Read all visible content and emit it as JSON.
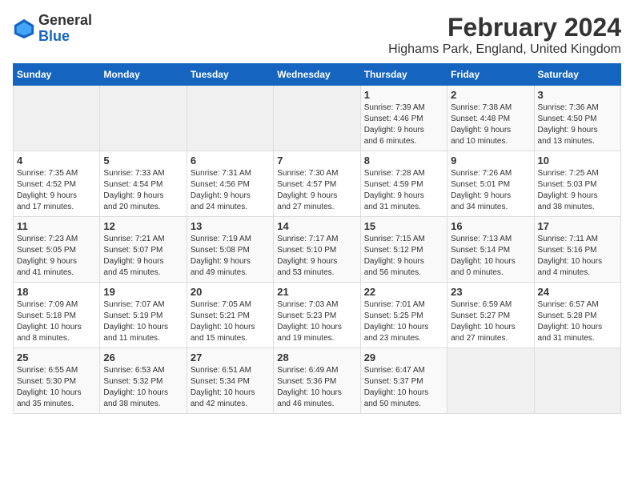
{
  "app": {
    "name_general": "General",
    "name_blue": "Blue"
  },
  "title": "February 2024",
  "subtitle": "Highams Park, England, United Kingdom",
  "days_of_week": [
    "Sunday",
    "Monday",
    "Tuesday",
    "Wednesday",
    "Thursday",
    "Friday",
    "Saturday"
  ],
  "weeks": [
    [
      {
        "day": "",
        "info": ""
      },
      {
        "day": "",
        "info": ""
      },
      {
        "day": "",
        "info": ""
      },
      {
        "day": "",
        "info": ""
      },
      {
        "day": "1",
        "info": "Sunrise: 7:39 AM\nSunset: 4:46 PM\nDaylight: 9 hours\nand 6 minutes."
      },
      {
        "day": "2",
        "info": "Sunrise: 7:38 AM\nSunset: 4:48 PM\nDaylight: 9 hours\nand 10 minutes."
      },
      {
        "day": "3",
        "info": "Sunrise: 7:36 AM\nSunset: 4:50 PM\nDaylight: 9 hours\nand 13 minutes."
      }
    ],
    [
      {
        "day": "4",
        "info": "Sunrise: 7:35 AM\nSunset: 4:52 PM\nDaylight: 9 hours\nand 17 minutes."
      },
      {
        "day": "5",
        "info": "Sunrise: 7:33 AM\nSunset: 4:54 PM\nDaylight: 9 hours\nand 20 minutes."
      },
      {
        "day": "6",
        "info": "Sunrise: 7:31 AM\nSunset: 4:56 PM\nDaylight: 9 hours\nand 24 minutes."
      },
      {
        "day": "7",
        "info": "Sunrise: 7:30 AM\nSunset: 4:57 PM\nDaylight: 9 hours\nand 27 minutes."
      },
      {
        "day": "8",
        "info": "Sunrise: 7:28 AM\nSunset: 4:59 PM\nDaylight: 9 hours\nand 31 minutes."
      },
      {
        "day": "9",
        "info": "Sunrise: 7:26 AM\nSunset: 5:01 PM\nDaylight: 9 hours\nand 34 minutes."
      },
      {
        "day": "10",
        "info": "Sunrise: 7:25 AM\nSunset: 5:03 PM\nDaylight: 9 hours\nand 38 minutes."
      }
    ],
    [
      {
        "day": "11",
        "info": "Sunrise: 7:23 AM\nSunset: 5:05 PM\nDaylight: 9 hours\nand 41 minutes."
      },
      {
        "day": "12",
        "info": "Sunrise: 7:21 AM\nSunset: 5:07 PM\nDaylight: 9 hours\nand 45 minutes."
      },
      {
        "day": "13",
        "info": "Sunrise: 7:19 AM\nSunset: 5:08 PM\nDaylight: 9 hours\nand 49 minutes."
      },
      {
        "day": "14",
        "info": "Sunrise: 7:17 AM\nSunset: 5:10 PM\nDaylight: 9 hours\nand 53 minutes."
      },
      {
        "day": "15",
        "info": "Sunrise: 7:15 AM\nSunset: 5:12 PM\nDaylight: 9 hours\nand 56 minutes."
      },
      {
        "day": "16",
        "info": "Sunrise: 7:13 AM\nSunset: 5:14 PM\nDaylight: 10 hours\nand 0 minutes."
      },
      {
        "day": "17",
        "info": "Sunrise: 7:11 AM\nSunset: 5:16 PM\nDaylight: 10 hours\nand 4 minutes."
      }
    ],
    [
      {
        "day": "18",
        "info": "Sunrise: 7:09 AM\nSunset: 5:18 PM\nDaylight: 10 hours\nand 8 minutes."
      },
      {
        "day": "19",
        "info": "Sunrise: 7:07 AM\nSunset: 5:19 PM\nDaylight: 10 hours\nand 11 minutes."
      },
      {
        "day": "20",
        "info": "Sunrise: 7:05 AM\nSunset: 5:21 PM\nDaylight: 10 hours\nand 15 minutes."
      },
      {
        "day": "21",
        "info": "Sunrise: 7:03 AM\nSunset: 5:23 PM\nDaylight: 10 hours\nand 19 minutes."
      },
      {
        "day": "22",
        "info": "Sunrise: 7:01 AM\nSunset: 5:25 PM\nDaylight: 10 hours\nand 23 minutes."
      },
      {
        "day": "23",
        "info": "Sunrise: 6:59 AM\nSunset: 5:27 PM\nDaylight: 10 hours\nand 27 minutes."
      },
      {
        "day": "24",
        "info": "Sunrise: 6:57 AM\nSunset: 5:28 PM\nDaylight: 10 hours\nand 31 minutes."
      }
    ],
    [
      {
        "day": "25",
        "info": "Sunrise: 6:55 AM\nSunset: 5:30 PM\nDaylight: 10 hours\nand 35 minutes."
      },
      {
        "day": "26",
        "info": "Sunrise: 6:53 AM\nSunset: 5:32 PM\nDaylight: 10 hours\nand 38 minutes."
      },
      {
        "day": "27",
        "info": "Sunrise: 6:51 AM\nSunset: 5:34 PM\nDaylight: 10 hours\nand 42 minutes."
      },
      {
        "day": "28",
        "info": "Sunrise: 6:49 AM\nSunset: 5:36 PM\nDaylight: 10 hours\nand 46 minutes."
      },
      {
        "day": "29",
        "info": "Sunrise: 6:47 AM\nSunset: 5:37 PM\nDaylight: 10 hours\nand 50 minutes."
      },
      {
        "day": "",
        "info": ""
      },
      {
        "day": "",
        "info": ""
      }
    ]
  ]
}
